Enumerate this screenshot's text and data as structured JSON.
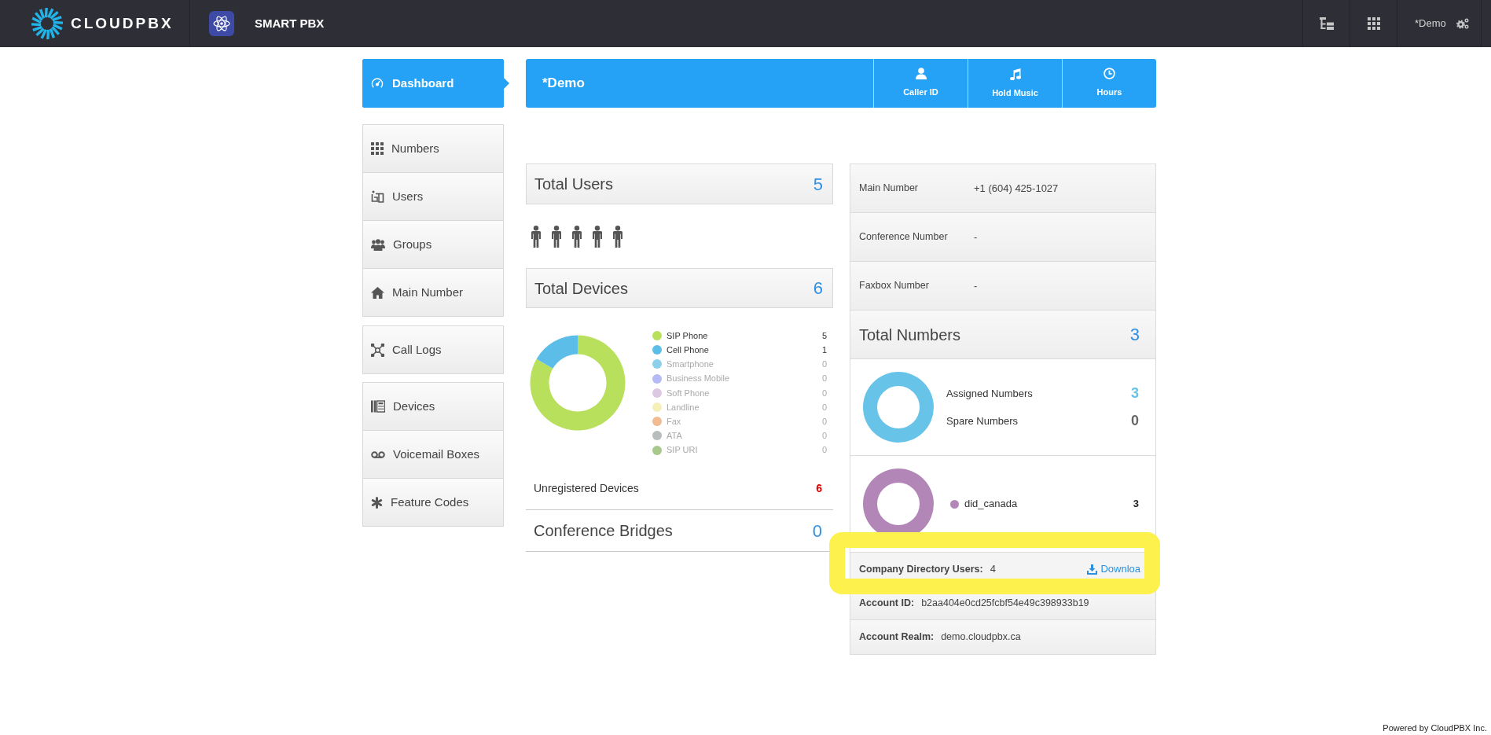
{
  "top_bar": {
    "logo": "CLOUDPBX",
    "app_name": "SMART PBX",
    "account": "*Demo"
  },
  "sidebar": {
    "groups": [
      {
        "items": [
          {
            "label": "Dashboard",
            "selected": true
          }
        ]
      },
      {
        "items": [
          {
            "label": "Numbers",
            "selected": false
          },
          {
            "label": "Users",
            "selected": false
          },
          {
            "label": "Groups",
            "selected": false
          },
          {
            "label": "Main Number",
            "selected": false
          }
        ]
      },
      {
        "items": [
          {
            "label": "Call Logs",
            "selected": false
          }
        ]
      },
      {
        "items": [
          {
            "label": "Devices",
            "selected": false
          },
          {
            "label": "Voicemail Boxes",
            "selected": false
          },
          {
            "label": "Feature Codes",
            "selected": false
          }
        ]
      }
    ]
  },
  "header": {
    "title": "*Demo",
    "actions": [
      {
        "label": "Caller ID"
      },
      {
        "label": "Hold Music"
      },
      {
        "label": "Hours"
      }
    ]
  },
  "overview": {
    "total_users": {
      "label": "Total Users",
      "value": "5"
    },
    "total_devices": {
      "label": "Total Devices",
      "value": "6",
      "chart_data": {
        "type": "donut",
        "categories": [
          "SIP Phone",
          "Cell Phone",
          "Smartphone",
          "Business Mobile",
          "Soft Phone",
          "Landline",
          "Fax",
          "ATA",
          "SIP URI"
        ],
        "values": [
          5,
          1,
          0,
          0,
          0,
          0,
          0,
          0,
          0
        ],
        "colors": [
          "#b8e05c",
          "#5bbde8",
          "#8dd0ec",
          "#b5bcf5",
          "#dcc8e2",
          "#f6f0b8",
          "#f3bc90",
          "#b8bdbd",
          "#a8c98c"
        ],
        "value_labels": [
          "5",
          "1",
          "0",
          "0",
          "0",
          "0",
          "0",
          "0",
          "0"
        ],
        "legend": "right"
      }
    },
    "unregistered_devices": {
      "label": "Unregistered Devices",
      "value": "6"
    },
    "conference_bridges": {
      "label": "Conference Bridges",
      "value": "0"
    }
  },
  "account_panel": {
    "numbers": [
      {
        "label": "Main Number",
        "value": "+1 (604) 425-1027"
      },
      {
        "label": "Conference Number",
        "value": "-"
      },
      {
        "label": "Faxbox Number",
        "value": "-"
      }
    ],
    "total_numbers": {
      "label": "Total Numbers",
      "value": "3",
      "breakdown": [
        {
          "label": "Assigned Numbers",
          "value": "3",
          "color": "#67c3e8"
        },
        {
          "label": "Spare Numbers",
          "value": "0"
        }
      ]
    },
    "number_types": [
      {
        "label": "did_canada",
        "value": "3",
        "color": "#b386b8"
      }
    ],
    "company_directory": {
      "label": "Company Directory Users:",
      "value": "4",
      "link": "Downloa",
      "highlighted": true
    },
    "account_info": [
      {
        "label": "Account ID:",
        "value": "b2aa404e0cd25fcbf54e49c398933b19"
      },
      {
        "label": "Account Realm:",
        "value": "demo.cloudpbx.ca"
      }
    ]
  },
  "footer": "Powered by CloudPBX Inc."
}
